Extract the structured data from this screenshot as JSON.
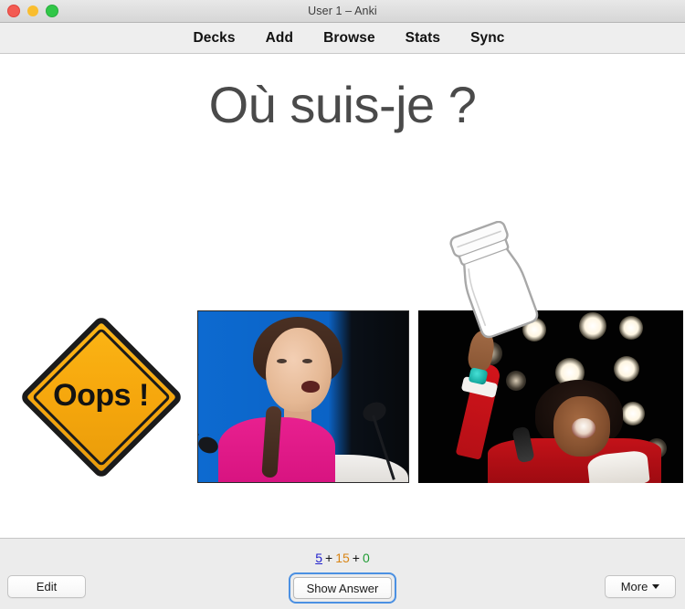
{
  "window": {
    "title": "User 1 – Anki",
    "traffic_lights": [
      {
        "name": "close",
        "color": "#f35b53"
      },
      {
        "name": "minimize",
        "color": "#f9bd2e"
      },
      {
        "name": "zoom",
        "color": "#31c748"
      }
    ]
  },
  "toolbar": {
    "items": [
      {
        "label": "Decks"
      },
      {
        "label": "Add"
      },
      {
        "label": "Browse"
      },
      {
        "label": "Stats"
      },
      {
        "label": "Sync"
      }
    ]
  },
  "card": {
    "question": "Où suis-je ?",
    "media": [
      {
        "name": "oops-road-sign",
        "kind": "image",
        "alt": "Yellow diamond road sign",
        "text": "Oops !",
        "sign_color": "#f5a623",
        "border_color": "#1b1b1b"
      },
      {
        "name": "speaker-photo",
        "kind": "image",
        "alt": "Young woman speaking at podium with microphones, blue backdrop"
      },
      {
        "name": "performer-photo",
        "kind": "image",
        "alt": "Singer in red outfit on stage with arm raised, stage lights"
      },
      {
        "name": "jar-line-drawing",
        "kind": "overlay",
        "alt": "Outline drawing of a tilted glass jar"
      }
    ]
  },
  "footer": {
    "counts": {
      "new": "5",
      "separator_1": "+",
      "learning": "15",
      "separator_2": "+",
      "due": "0",
      "new_color": "#2222cc",
      "learning_color": "#d98515",
      "due_color": "#1f9c33"
    },
    "edit_label": "Edit",
    "show_answer_label": "Show Answer",
    "more_label": "More",
    "focus_ring_color": "#4b90e2"
  }
}
